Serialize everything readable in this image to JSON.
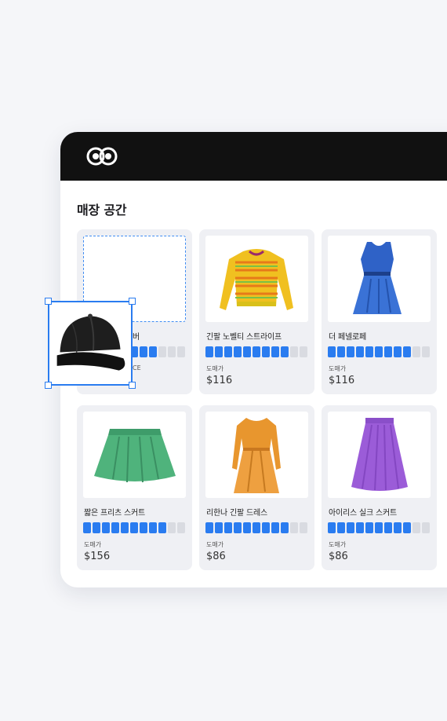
{
  "header": {
    "logo_icon": "infinity-logo-icon"
  },
  "section": {
    "title": "매장 공간"
  },
  "products": [
    {
      "name": "",
      "level": 8,
      "price_label": "",
      "price": "",
      "icon": "empty-slot",
      "hidden": true
    },
    {
      "name": "긴팔 노벨티 스트라이프",
      "level": 9,
      "price_label": "도매가",
      "price": "$116",
      "icon": "sweater-icon"
    },
    {
      "name": "더 페넬로페",
      "level": 9,
      "price_label": "도매가",
      "price": "$116",
      "icon": "blue-dress-icon"
    },
    {
      "name": "짧은 프리츠 스커트",
      "level": 9,
      "price_label": "도매가",
      "price": "$156",
      "icon": "green-skirt-icon"
    },
    {
      "name": "리한나 긴팔 드레스",
      "level": 9,
      "price_label": "도매가",
      "price": "$86",
      "icon": "orange-dress-icon"
    },
    {
      "name": "아이리스 실크 스커트",
      "level": 9,
      "price_label": "도매가",
      "price": "$86",
      "icon": "purple-skirt-icon"
    }
  ],
  "partial_text": {
    "card1_name_tail": "버",
    "card1_label_tail": "CE"
  },
  "dragged_item": {
    "icon": "baseball-cap-icon"
  },
  "bar_segments": 11,
  "colors": {
    "accent": "#2a7cf0",
    "header_bg": "#111111",
    "card_bg": "#eff0f4"
  }
}
